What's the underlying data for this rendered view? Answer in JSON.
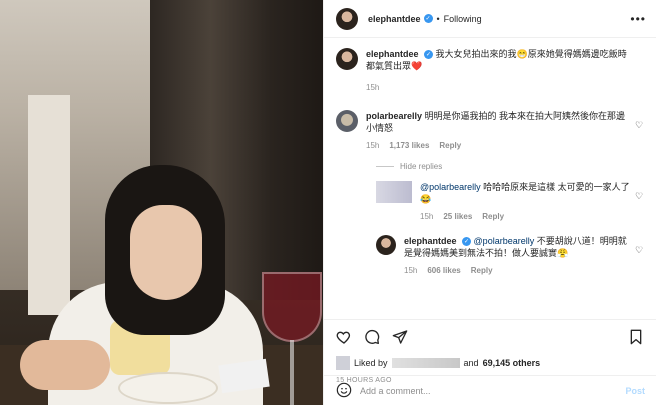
{
  "header": {
    "username": "elephantdee",
    "separator": "•",
    "follow_status": "Following",
    "more": "•••"
  },
  "caption": {
    "username": "elephantdee",
    "text": "我大女兒拍出來的我😁原來她覺得媽媽邊吃飯時都氣質出眾❤️",
    "time": "15h"
  },
  "comments": [
    {
      "username": "polarbearelly",
      "text": "明明是你逼我拍的 我本來在拍大阿姨然後你在那邊小情怒",
      "time": "15h",
      "likes": "1,173 likes",
      "reply_label": "Reply"
    }
  ],
  "hide_replies": "Hide replies",
  "replies": [
    {
      "mention": "@polarbearelly",
      "text": " 哈哈哈原來是這樣 太可愛的一家人了😂",
      "time": "15h",
      "likes": "25 likes",
      "reply_label": "Reply"
    },
    {
      "username": "elephantdee",
      "mention": "@polarbearelly",
      "text": " 不要胡說八道！明明就是覺得媽媽美到無法不拍！做人要誠實😤",
      "time": "15h",
      "likes": "606 likes",
      "reply_label": "Reply"
    }
  ],
  "likes": {
    "prefix": "Liked by",
    "connector": "and",
    "others": "69,145 others"
  },
  "timestamp": "15 HOURS AGO",
  "add_comment": {
    "placeholder": "Add a comment...",
    "post_label": "Post"
  },
  "colors": {
    "verified": "#3897f0",
    "heart": "#ed4956",
    "link": "#00376b",
    "muted": "#8e8e8e",
    "post_disabled": "#b3dbff"
  }
}
